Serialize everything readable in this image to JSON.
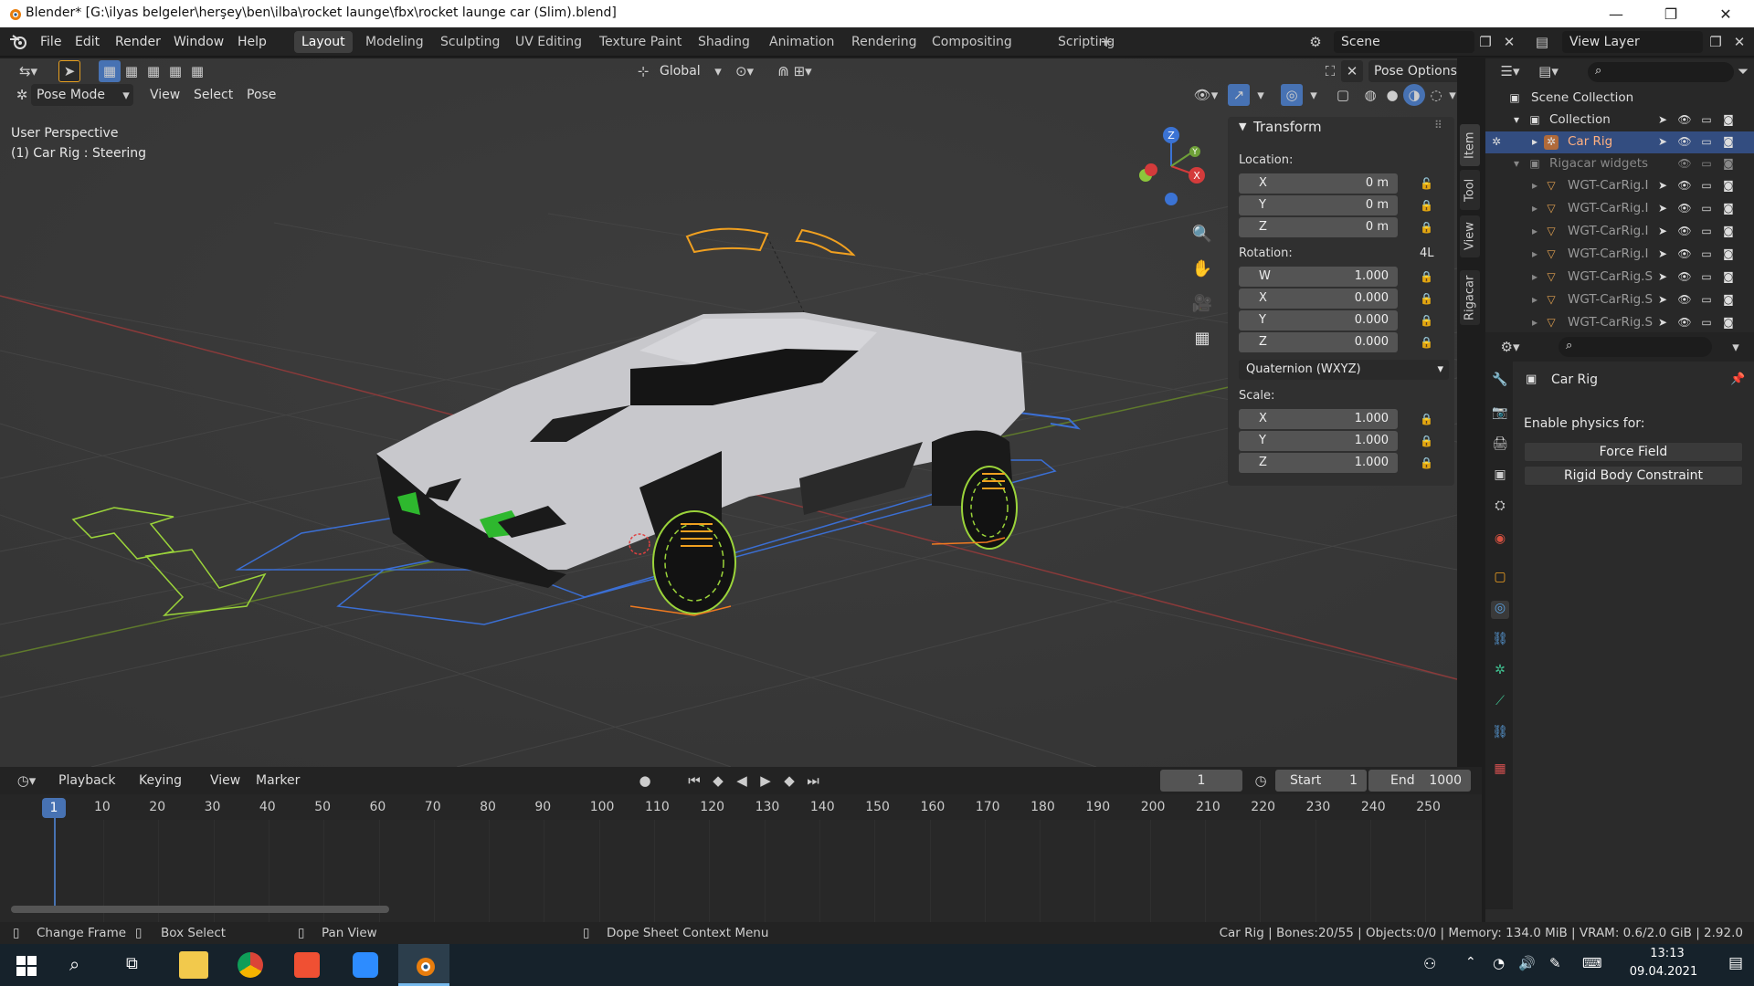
{
  "window": {
    "title": "Blender* [G:\\ilyas belgeler\\herşey\\ben\\ilba\\rocket launge\\fbx\\rocket launge car (Slim).blend]",
    "minimize": "—",
    "maximize": "❐",
    "close": "✕"
  },
  "menu": [
    "File",
    "Edit",
    "Render",
    "Window",
    "Help"
  ],
  "workspaces": [
    "Layout",
    "Modeling",
    "Sculpting",
    "UV Editing",
    "Texture Paint",
    "Shading",
    "Animation",
    "Rendering",
    "Compositing",
    "Scripting"
  ],
  "add_workspace": "+",
  "scene": {
    "label": "Scene",
    "view_layer": "View Layer"
  },
  "viewport": {
    "mode": "Pose Mode",
    "header_menus": [
      "View",
      "Select",
      "Pose"
    ],
    "transform_orientation": "Global",
    "pose_options": "Pose Options",
    "info_line1": "User Perspective",
    "info_line2": "(1) Car Rig : Steering",
    "gizmo": {
      "x": "X",
      "y": "Y",
      "z": "Z"
    }
  },
  "npanel": {
    "header": "Transform",
    "location_label": "Location:",
    "location": [
      {
        "axis": "X",
        "value": "0 m"
      },
      {
        "axis": "Y",
        "value": "0 m"
      },
      {
        "axis": "Z",
        "value": "0 m"
      }
    ],
    "rotation_label": "Rotation:",
    "rotation_mode_short": "4L",
    "rotation": [
      {
        "axis": "W",
        "value": "1.000"
      },
      {
        "axis": "X",
        "value": "0.000"
      },
      {
        "axis": "Y",
        "value": "0.000"
      },
      {
        "axis": "Z",
        "value": "0.000"
      }
    ],
    "rotation_mode": "Quaternion (WXYZ)",
    "scale_label": "Scale:",
    "scale": [
      {
        "axis": "X",
        "value": "1.000"
      },
      {
        "axis": "Y",
        "value": "1.000"
      },
      {
        "axis": "Z",
        "value": "1.000"
      }
    ],
    "tabs": [
      "Item",
      "Tool",
      "View",
      "Rigacar"
    ]
  },
  "outliner": {
    "scene_collection": "Scene Collection",
    "collection": "Collection",
    "car_rig": "Car Rig",
    "rigacar_widgets": "Rigacar widgets",
    "widgets": [
      "WGT-CarRig.I",
      "WGT-CarRig.I",
      "WGT-CarRig.I",
      "WGT-CarRig.I",
      "WGT-CarRig.S",
      "WGT-CarRig.S",
      "WGT-CarRig.S"
    ]
  },
  "properties": {
    "object_name": "Car Rig",
    "enable_physics_label": "Enable physics for:",
    "buttons": [
      "Force Field",
      "Rigid Body Constraint"
    ]
  },
  "timeline": {
    "menus": [
      "Playback",
      "Keying",
      "View",
      "Marker"
    ],
    "current_frame": "1",
    "start_label": "Start",
    "start": "1",
    "end_label": "End",
    "end": "1000",
    "ruler": [
      "10",
      "20",
      "30",
      "40",
      "50",
      "60",
      "70",
      "80",
      "90",
      "100",
      "110",
      "120",
      "130",
      "140",
      "150",
      "160",
      "170",
      "180",
      "190",
      "200",
      "210",
      "220",
      "230",
      "240",
      "250"
    ],
    "playhead": "1"
  },
  "statusbar": {
    "hints": [
      "Change Frame",
      "Box Select",
      "Pan View",
      "Dope Sheet Context Menu"
    ],
    "stats": "Car Rig | Bones:20/55 | Objects:0/0 | Memory: 134.0 MiB | VRAM: 0.6/2.0 GiB | 2.92.0"
  },
  "taskbar": {
    "time": "13:13",
    "date": "09.04.2021",
    "icons": [
      "windows-start-icon",
      "search-icon",
      "task-view-icon",
      "file-explorer-icon",
      "chrome-icon",
      "git-icon",
      "zoom-icon",
      "blender-icon"
    ]
  },
  "colors": {
    "accent": "#4772b3",
    "bone_green": "#9bd43a",
    "bone_orange": "#f0a020",
    "widget_blue": "#3b6fd4"
  }
}
